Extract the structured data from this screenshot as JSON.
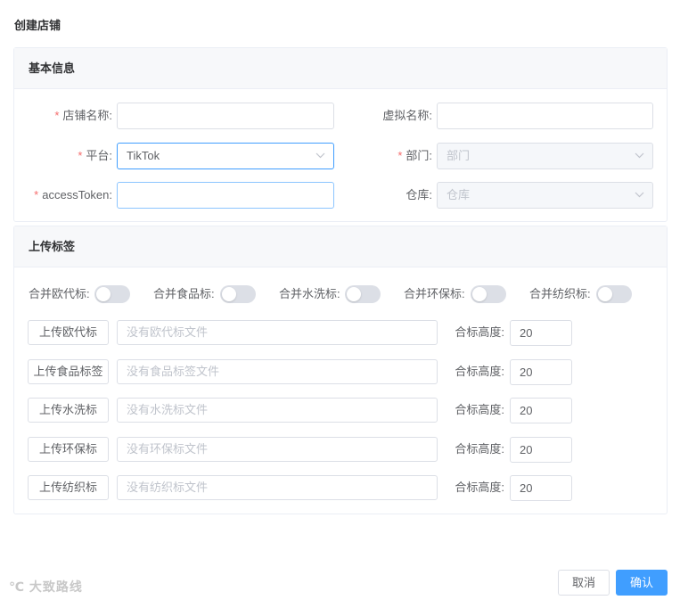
{
  "dialog": {
    "title": "创建店铺"
  },
  "basic_info": {
    "section_title": "基本信息",
    "store_name": {
      "label": "店铺名称:",
      "value": ""
    },
    "virtual_name": {
      "label": "虚拟名称:",
      "value": ""
    },
    "platform": {
      "label": "平台:",
      "value": "TikTok"
    },
    "department": {
      "label": "部门:",
      "placeholder": "部门"
    },
    "access_token": {
      "label": "accessToken:",
      "value": ""
    },
    "warehouse": {
      "label": "仓库:",
      "placeholder": "仓库"
    }
  },
  "upload_labels": {
    "section_title": "上传标签",
    "switches": [
      {
        "label": "合并欧代标:",
        "on": false
      },
      {
        "label": "合并食品标:",
        "on": false
      },
      {
        "label": "合并水洗标:",
        "on": false
      },
      {
        "label": "合并环保标:",
        "on": false
      },
      {
        "label": "合并纺织标:",
        "on": false
      }
    ],
    "rows": [
      {
        "button": "上传欧代标",
        "file_placeholder": "没有欧代标文件",
        "height_label": "合标高度:",
        "height_value": "20"
      },
      {
        "button": "上传食品标签",
        "file_placeholder": "没有食品标签文件",
        "height_label": "合标高度:",
        "height_value": "20"
      },
      {
        "button": "上传水洗标",
        "file_placeholder": "没有水洗标文件",
        "height_label": "合标高度:",
        "height_value": "20"
      },
      {
        "button": "上传环保标",
        "file_placeholder": "没有环保标文件",
        "height_label": "合标高度:",
        "height_value": "20"
      },
      {
        "button": "上传纺织标",
        "file_placeholder": "没有纺织标文件",
        "height_label": "合标高度:",
        "height_value": "20"
      }
    ]
  },
  "footer": {
    "cancel_label": "取消",
    "confirm_label": "确认"
  },
  "watermark": {
    "text": "大致路线"
  },
  "colors": {
    "primary": "#409eff",
    "required": "#f56c6c",
    "border": "#dcdfe6"
  }
}
